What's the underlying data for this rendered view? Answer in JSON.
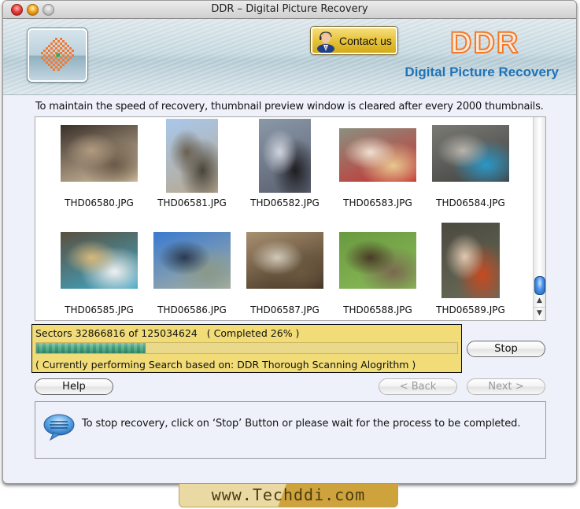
{
  "window": {
    "title": "DDR – Digital Picture Recovery",
    "controls": [
      "close",
      "minimize",
      "zoom"
    ]
  },
  "header": {
    "logo_icon": "ddr-checker-logo-icon",
    "contact_button": {
      "label": "Contact us",
      "icon": "support-person-icon"
    },
    "brand_name": "DDR",
    "brand_subtitle": "Digital Picture Recovery",
    "brand_color": "#f07a2a",
    "subtitle_color": "#1f73b7"
  },
  "info_text": "To maintain the speed of recovery, thumbnail preview window is cleared after every 2000 thumbnails.",
  "thumbnails": [
    {
      "name": "THD06580.JPG",
      "subject": "woman-on-phone"
    },
    {
      "name": "THD06581.JPG",
      "subject": "soldier-statue"
    },
    {
      "name": "THD06582.JPG",
      "subject": "two-people-standing"
    },
    {
      "name": "THD06583.JPG",
      "subject": "child-at-table"
    },
    {
      "name": "THD06584.JPG",
      "subject": "blue-bicycle"
    },
    {
      "name": "THD06585.JPG",
      "subject": "people-eating"
    },
    {
      "name": "THD06586.JPG",
      "subject": "statue-sky"
    },
    {
      "name": "THD06587.JPG",
      "subject": "building"
    },
    {
      "name": "THD06588.JPG",
      "subject": "duck"
    },
    {
      "name": "THD06589.JPG",
      "subject": "man-on-sofa"
    }
  ],
  "scrollbar": {
    "position": 0.95
  },
  "progress": {
    "sectors_text": "Sectors 32866816 of 125034624   ( Completed 26% )",
    "sectors_done": 32866816,
    "sectors_total": 125034624,
    "percent": 26,
    "algorithm_text": "( Currently performing Search based on: DDR Thorough Scanning Alogrithm )",
    "panel_color": "#f1dc78"
  },
  "buttons": {
    "stop": "Stop",
    "help": "Help",
    "back": "< Back",
    "next": "Next >"
  },
  "message": {
    "icon": "speech-bubble-icon",
    "text": "To stop recovery, click on ‘Stop’ Button or please wait for the process to be completed."
  },
  "footer": {
    "text": "www.Techddi.com"
  }
}
